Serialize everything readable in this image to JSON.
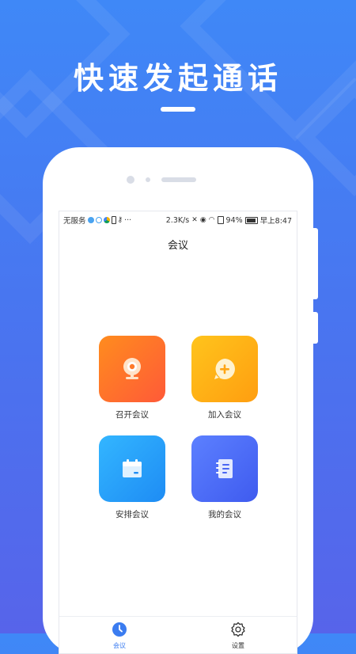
{
  "promo": {
    "title": "快速发起通话"
  },
  "status_bar": {
    "carrier": "无服务",
    "speed": "2.3K/s",
    "battery": "94%",
    "time": "早上8:47"
  },
  "header": {
    "title": "会议"
  },
  "tiles": [
    {
      "label": "召开会议",
      "icon": "webcam-icon",
      "color_from": "#ff8a1c",
      "color_to": "#ff5a3a"
    },
    {
      "label": "加入会议",
      "icon": "add-chat-icon",
      "color_from": "#ffc21a",
      "color_to": "#ff9f0d"
    },
    {
      "label": "安排会议",
      "icon": "calendar-icon",
      "color_from": "#2fb2ff",
      "color_to": "#1f8ff5"
    },
    {
      "label": "我的会议",
      "icon": "notebook-icon",
      "color_from": "#5a7bff",
      "color_to": "#3f5cf0"
    }
  ],
  "tabbar": {
    "items": [
      {
        "label": "会议",
        "icon": "clock-icon",
        "active": true
      },
      {
        "label": "设置",
        "icon": "gear-icon",
        "active": false
      }
    ],
    "active_color": "#3b7cf0"
  }
}
